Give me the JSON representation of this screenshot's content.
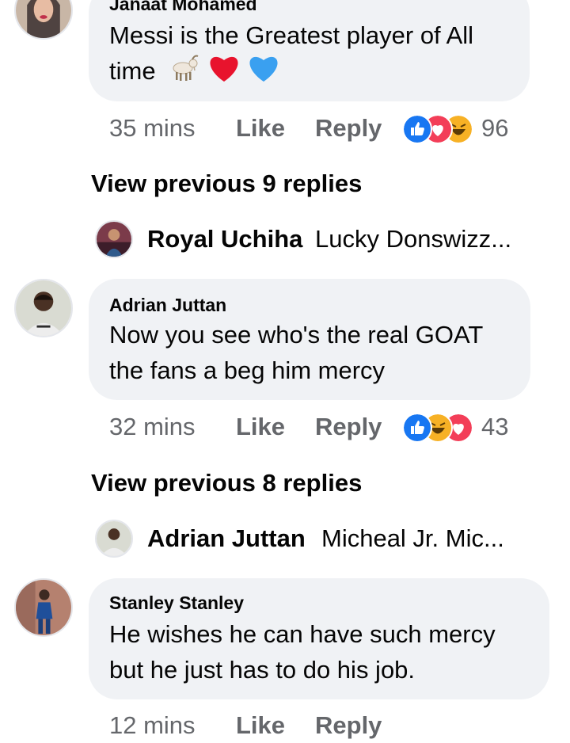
{
  "comments": [
    {
      "author": "Janaat Mohamed",
      "text_lines": [
        "Messi is the Greatest player of All",
        "time"
      ],
      "emojis": [
        "goat-emoji",
        "red-heart-emoji",
        "blue-heart-emoji"
      ],
      "time": "35 mins",
      "like_label": "Like",
      "reply_label": "Reply",
      "reactions": [
        "like",
        "love",
        "haha"
      ],
      "reaction_count": "96",
      "view_previous": "View previous 9 replies",
      "latest_reply": {
        "author": "Royal Uchiha",
        "text": "Lucky Donswizz..."
      }
    },
    {
      "author": "Adrian Juttan",
      "text_lines": [
        "Now you see who's the real GOAT",
        "the fans a beg him mercy"
      ],
      "time": "32 mins",
      "like_label": "Like",
      "reply_label": "Reply",
      "reactions": [
        "like",
        "haha",
        "love"
      ],
      "reaction_count": "43",
      "view_previous": "View previous 8 replies",
      "latest_reply": {
        "author": "Adrian Juttan",
        "text": "Micheal Jr. Mic..."
      }
    },
    {
      "author": "Stanley Stanley",
      "text_lines": [
        "He wishes he can have such mercy",
        "but he just has to do his job."
      ],
      "time": "12 mins",
      "like_label": "Like",
      "reply_label": "Reply"
    }
  ],
  "colors": {
    "bubble": "#f0f2f5",
    "meta_text": "#65676b",
    "like_blue": "#1877f2",
    "love_red": "#f33e58",
    "haha_yellow": "#f7b125"
  }
}
